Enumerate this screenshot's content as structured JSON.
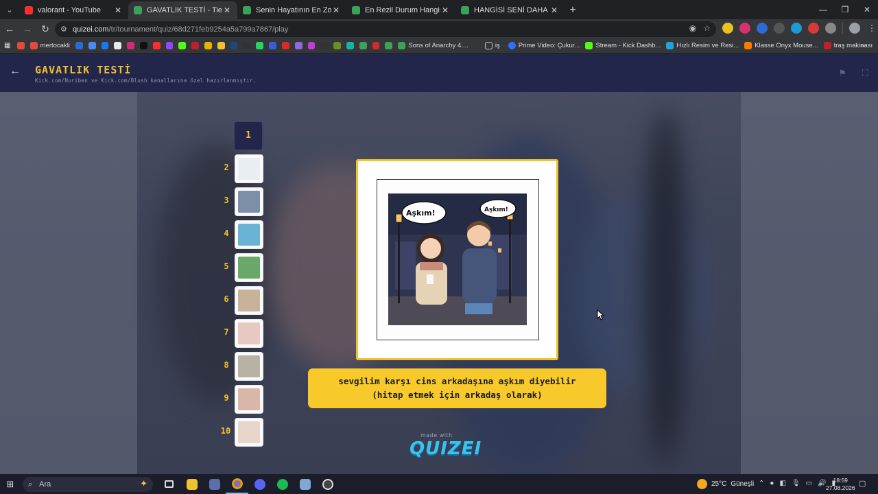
{
  "browser": {
    "tabs": [
      {
        "title": "valorant - YouTube",
        "color": "#ff2e2e",
        "active": false
      },
      {
        "title": "GAVATLIK TESTİ - Tier List, Kör",
        "color": "#3aa357",
        "active": true
      },
      {
        "title": "Senin Hayatının En Zor Seçimi",
        "color": "#3aa357",
        "active": false
      },
      {
        "title": "En Rezil Durum Hangisi? - Tier",
        "color": "#3aa357",
        "active": false
      },
      {
        "title": "HANGİSİ SENİ DAHA ÇOK KORU",
        "color": "#3aa357",
        "active": false
      }
    ],
    "url_host": "quizei.com",
    "url_path": "/tr/tournament/quiz/68d271feb9254a5a799a7867/play",
    "bookmarks": [
      {
        "label": "mertocakli",
        "color": "#e14b3a"
      },
      {
        "label": "Sons of Anarchy 4....",
        "color": "#3aa357"
      },
      {
        "label": "iş",
        "color": "#c7c7c7"
      },
      {
        "label": "Prime Video: Çukur...",
        "color": "#2f6fff"
      },
      {
        "label": "Stream - Kick Dashb...",
        "color": "#53fc18"
      },
      {
        "label": "Hızlı Resim ve Resi...",
        "color": "#1fa3e0"
      },
      {
        "label": "Klasse Onyx Mouse...",
        "color": "#ff7a00"
      },
      {
        "label": "traş makinası",
        "color": "#c41d2b"
      }
    ]
  },
  "quiz": {
    "title": "GAVATLIK TESTİ",
    "subtitle": "Kick.com/Nuriben ve Kick.com/Blush kanallarına özel hazırlanmıştır.",
    "ranks": [
      "1",
      "2",
      "3",
      "4",
      "5",
      "6",
      "7",
      "8",
      "9",
      "10"
    ],
    "bubble_left": "Aşkım!",
    "bubble_right": "Aşkım!",
    "caption": "sevgilim karşı cins arkadaşına aşkım diyebilir\n(hitap etmek için arkadaş olarak)",
    "made_with": "made with",
    "brand": "QUIZEI"
  },
  "taskbar": {
    "search_placeholder": "Ara",
    "weather_temp": "25°C",
    "weather_text": "Güneşli",
    "time": "18:59",
    "date": "27.08.2026"
  }
}
